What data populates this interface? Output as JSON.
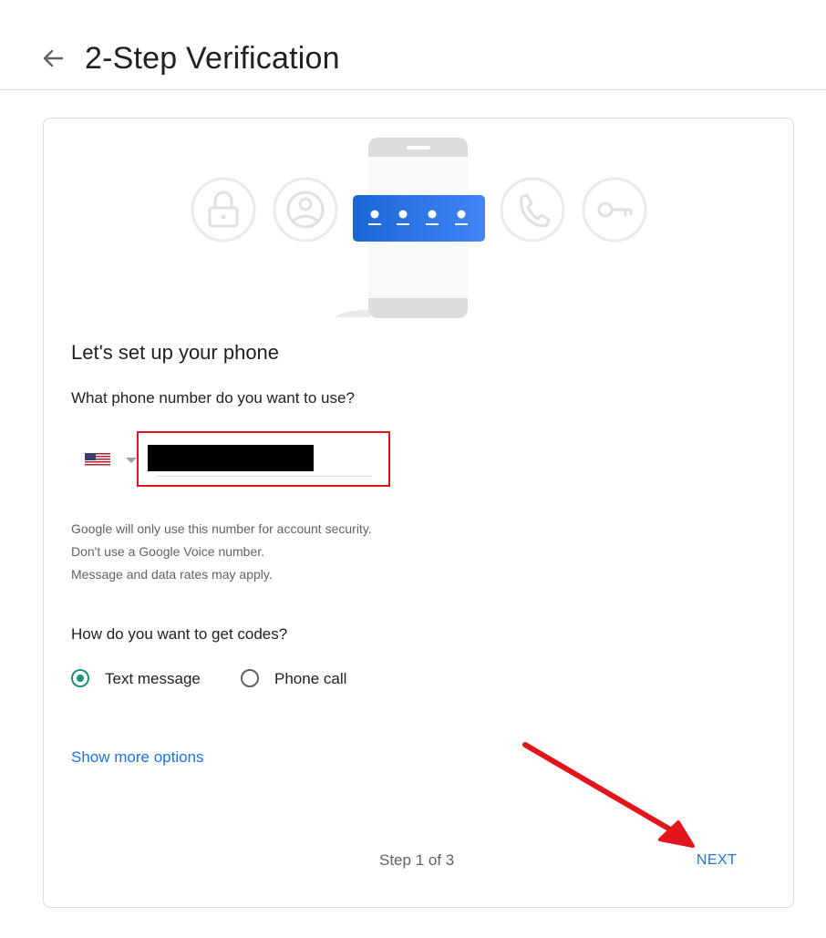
{
  "header": {
    "title": "2-Step Verification",
    "back_icon": "arrow-left-icon"
  },
  "illustration": {
    "icons": [
      "lock-icon",
      "account-circle-icon",
      "phone-icon",
      "key-icon"
    ],
    "code_card_icon": "password-dots-icon",
    "accent": "#1a73e8"
  },
  "setup": {
    "heading": "Let's set up your phone",
    "question": "What phone number do you want to use?",
    "country": {
      "flag_icon": "us-flag-icon",
      "dropdown_icon": "caret-down-icon"
    },
    "phone_value": "",
    "notes": [
      "Google will only use this number for account security.",
      "Don't use a Google Voice number.",
      "Message and data rates may apply."
    ]
  },
  "codes": {
    "question": "How do you want to get codes?",
    "options": [
      {
        "label": "Text message",
        "selected": true
      },
      {
        "label": "Phone call",
        "selected": false
      }
    ],
    "selected_color": "#1e8e7e"
  },
  "more_options_label": "Show more options",
  "footer": {
    "step_text": "Step 1 of 3",
    "next_label": "NEXT"
  },
  "annotations": {
    "highlight_color": "#e2141c",
    "arrow_icon": "red-arrow-icon"
  }
}
